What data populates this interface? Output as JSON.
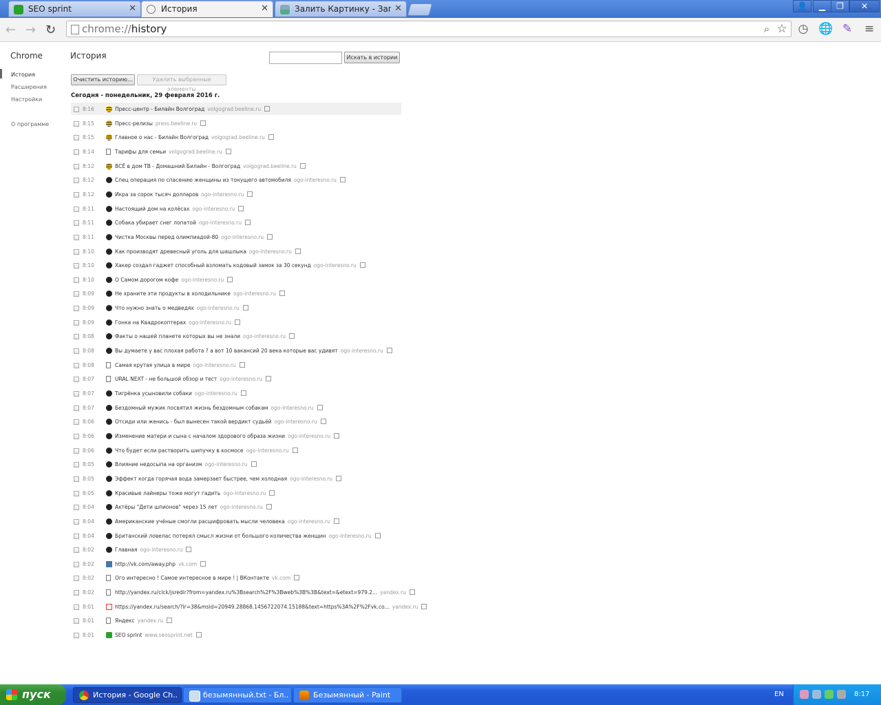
{
  "browser": {
    "tabs": [
      {
        "title": "SEO sprint",
        "favicon": "seosprint-icon"
      },
      {
        "title": "История",
        "favicon": "history-icon"
      },
      {
        "title": "Залить Картинку - Загрузи",
        "favicon": "image-host-icon"
      }
    ],
    "url_scheme": "chrome://",
    "url_path": "history"
  },
  "sidebar": {
    "title": "Chrome",
    "items": [
      "История",
      "Расширения",
      "Настройки"
    ],
    "about": "О программе"
  },
  "main": {
    "title": "История",
    "search_button": "Искать в истории",
    "clear_button": "Очистить историю...",
    "remove_button": "Удалить выбранные элементы",
    "day_heading": "Сегодня - понедельник, 29 февраля 2016 г."
  },
  "entries": [
    {
      "time": "8:16",
      "title": "Пресс-центр - Билайн Волгоград",
      "domain": "volgograd.beeline.ru",
      "icon": "beeline"
    },
    {
      "time": "8:15",
      "title": "Пресс-релизы",
      "domain": "press.beeline.ru",
      "icon": "beeline"
    },
    {
      "time": "8:15",
      "title": "Главное о нас - Билайн Волгоград",
      "domain": "volgograd.beeline.ru",
      "icon": "beeline"
    },
    {
      "time": "8:14",
      "title": "Тарифы для семьи",
      "domain": "volgograd.beeline.ru",
      "icon": "page"
    },
    {
      "time": "8:12",
      "title": "ВСЁ в дом ТВ - Домашний Билайн - Волгоград",
      "domain": "volgograd.beeline.ru",
      "icon": "beeline"
    },
    {
      "time": "8:12",
      "title": "Спец операция по спасению женщины из тонущего автомобиля",
      "domain": "ogo-interesno.ru",
      "icon": "ogo"
    },
    {
      "time": "8:12",
      "title": "Икра за сорок тысяч долларов",
      "domain": "ogo-interesno.ru",
      "icon": "ogo"
    },
    {
      "time": "8:11",
      "title": "Настоящий дом на колёсах",
      "domain": "ogo-interesno.ru",
      "icon": "ogo"
    },
    {
      "time": "8:11",
      "title": "Собака убирает снег лопатой",
      "domain": "ogo-interesno.ru",
      "icon": "ogo"
    },
    {
      "time": "8:11",
      "title": "Чистка Москвы перед олимпиадой-80",
      "domain": "ogo-interesno.ru",
      "icon": "ogo"
    },
    {
      "time": "8:10",
      "title": "Как производят древесный уголь для шашлыка",
      "domain": "ogo-interesno.ru",
      "icon": "ogo"
    },
    {
      "time": "8:10",
      "title": "Хакер создал гаджет способный взломать кодовый замок за 30 секунд",
      "domain": "ogo-interesno.ru",
      "icon": "ogo"
    },
    {
      "time": "8:10",
      "title": "О Самом дорогом кофе",
      "domain": "ogo-interesno.ru",
      "icon": "ogo"
    },
    {
      "time": "8:09",
      "title": "Не храните эти продукты в холодильнике",
      "domain": "ogo-interesno.ru",
      "icon": "ogo"
    },
    {
      "time": "8:09",
      "title": "Что нужно знать о медведях",
      "domain": "ogo-interesno.ru",
      "icon": "ogo"
    },
    {
      "time": "8:09",
      "title": "Гонка на Квадрокоптерах",
      "domain": "ogo-interesno.ru",
      "icon": "ogo"
    },
    {
      "time": "8:08",
      "title": "Факты о нашей планете которых вы не знали",
      "domain": "ogo-interesno.ru",
      "icon": "ogo"
    },
    {
      "time": "8:08",
      "title": "Вы думаете у вас плохая работа ? а вот 10 вакансий 20 века которые вас удивят",
      "domain": "ogo-interesno.ru",
      "icon": "ogo"
    },
    {
      "time": "8:08",
      "title": "Самая крутая улица в мире",
      "domain": "ogo-interesno.ru",
      "icon": "page"
    },
    {
      "time": "8:07",
      "title": "URAL NEXT - не большой обзор и тест",
      "domain": "ogo-interesno.ru",
      "icon": "page"
    },
    {
      "time": "8:07",
      "title": "Тигрёнка усыновили собаки",
      "domain": "ogo-interesno.ru",
      "icon": "ogo"
    },
    {
      "time": "8:07",
      "title": "Бездомный мужик посвятил жизнь бездомным собакам",
      "domain": "ogo-interesno.ru",
      "icon": "ogo"
    },
    {
      "time": "8:06",
      "title": "Отсиди или женись - был вынесен такой вердикт судьёй",
      "domain": "ogo-interesno.ru",
      "icon": "ogo"
    },
    {
      "time": "8:06",
      "title": "Изменение матери и сына с началом здорового образа жизни",
      "domain": "ogo-interesno.ru",
      "icon": "ogo"
    },
    {
      "time": "8:06",
      "title": "Что будет если растворить шипучку в космосе",
      "domain": "ogo-interesno.ru",
      "icon": "ogo"
    },
    {
      "time": "8:05",
      "title": "Влияние недосыпа на организм",
      "domain": "ogo-interesno.ru",
      "icon": "ogo"
    },
    {
      "time": "8:05",
      "title": "Эффект когда горячая вода замерзает быстрее, чем холодная",
      "domain": "ogo-interesno.ru",
      "icon": "ogo"
    },
    {
      "time": "8:05",
      "title": "Красивые лайнеры тоже могут гадить",
      "domain": "ogo-interesno.ru",
      "icon": "ogo"
    },
    {
      "time": "8:04",
      "title": "Актёры \"Дети шпионов\" через 15 лет",
      "domain": "ogo-interesno.ru",
      "icon": "ogo"
    },
    {
      "time": "8:04",
      "title": "Американские учёные смогли расшифровать мысли человека",
      "domain": "ogo-interesno.ru",
      "icon": "ogo"
    },
    {
      "time": "8:04",
      "title": "Британский ловелас потерял смысл жизни от большого количества женщин",
      "domain": "ogo-interesno.ru",
      "icon": "ogo"
    },
    {
      "time": "8:02",
      "title": "Главная",
      "domain": "ogo-interesno.ru",
      "icon": "ogo"
    },
    {
      "time": "8:02",
      "title": "http://vk.com/away.php",
      "domain": "vk.com",
      "icon": "vk"
    },
    {
      "time": "8:02",
      "title": "Ого интересно ! Самое интересное в мире ! | ВКонтакте",
      "domain": "vk.com",
      "icon": "page"
    },
    {
      "time": "8:02",
      "title": "http://yandex.ru/clck/jsredir?from=yandex.ru%3Bsearch%2F%3Bweb%3B%3B&text=&etext=979.2...",
      "domain": "yandex.ru",
      "icon": "page"
    },
    {
      "time": "8:01",
      "title": "https://yandex.ru/search/?lr=38&msid=20949.28868.1456722074.15188&text=https%3A%2F%2Fvk.co...",
      "domain": "yandex.ru",
      "icon": "yandex"
    },
    {
      "time": "8:01",
      "title": "Яндекс",
      "domain": "yandex.ru",
      "icon": "page"
    },
    {
      "time": "8:01",
      "title": "SEO sprint",
      "domain": "www.seosprint.net",
      "icon": "seo"
    }
  ],
  "taskbar": {
    "start_label": "пуск",
    "tasks": [
      {
        "label": "История - Google Ch...",
        "icon": "chrome-icon"
      },
      {
        "label": "безымянный.txt - Бл...",
        "icon": "notepad-icon"
      },
      {
        "label": "Безымянный - Paint",
        "icon": "paint-icon"
      }
    ],
    "language": "EN",
    "clock": "8:17"
  }
}
